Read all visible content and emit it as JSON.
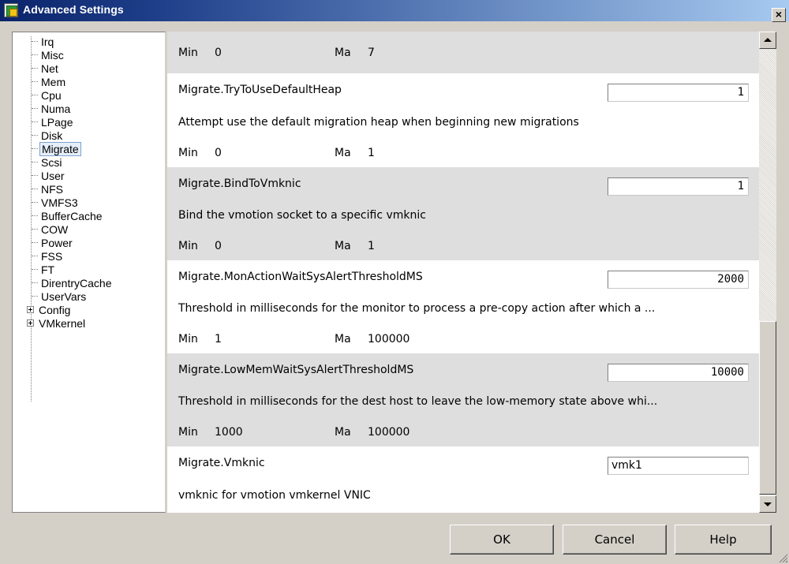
{
  "window": {
    "title": "Advanced Settings",
    "close_label": "×"
  },
  "tree": {
    "items": [
      {
        "label": "Irq"
      },
      {
        "label": "Misc"
      },
      {
        "label": "Net"
      },
      {
        "label": "Mem"
      },
      {
        "label": "Cpu"
      },
      {
        "label": "Numa"
      },
      {
        "label": "LPage"
      },
      {
        "label": "Disk"
      },
      {
        "label": "Migrate"
      },
      {
        "label": "Scsi"
      },
      {
        "label": "User"
      },
      {
        "label": "NFS"
      },
      {
        "label": "VMFS3"
      },
      {
        "label": "BufferCache"
      },
      {
        "label": "COW"
      },
      {
        "label": "Power"
      },
      {
        "label": "FSS"
      },
      {
        "label": "FT"
      },
      {
        "label": "DirentryCache"
      },
      {
        "label": "UserVars"
      },
      {
        "label": "Config"
      },
      {
        "label": "VMkernel"
      }
    ],
    "selected": "Migrate"
  },
  "settings": {
    "top_partial": {
      "min_label": "Min",
      "min": "0",
      "max_label": "Ma",
      "max": "7"
    },
    "rows": [
      {
        "name": "Migrate.TryToUseDefaultHeap",
        "value": "1",
        "desc": "Attempt use the default migration heap when beginning new migrations",
        "min_label": "Min",
        "min": "0",
        "max_label": "Ma",
        "max": "1"
      },
      {
        "name": "Migrate.BindToVmknic",
        "value": "1",
        "desc": "Bind the vmotion socket to a specific vmknic",
        "min_label": "Min",
        "min": "0",
        "max_label": "Ma",
        "max": "1"
      },
      {
        "name": "Migrate.MonActionWaitSysAlertThresholdMS",
        "value": "2000",
        "desc": "Threshold in milliseconds for the monitor to process a pre-copy action after which a ...",
        "min_label": "Min",
        "min": "1",
        "max_label": "Ma",
        "max": "100000"
      },
      {
        "name": "Migrate.LowMemWaitSysAlertThresholdMS",
        "value": "10000",
        "desc": "Threshold in milliseconds for the dest host to leave the low-memory state above whi...",
        "min_label": "Min",
        "min": "1000",
        "max_label": "Ma",
        "max": "100000"
      },
      {
        "name": "Migrate.Vmknic",
        "value": "vmk1",
        "desc": "vmknic for vmotion vmkernel VNIC"
      }
    ]
  },
  "buttons": {
    "ok": "OK",
    "cancel": "Cancel",
    "help": "Help"
  }
}
